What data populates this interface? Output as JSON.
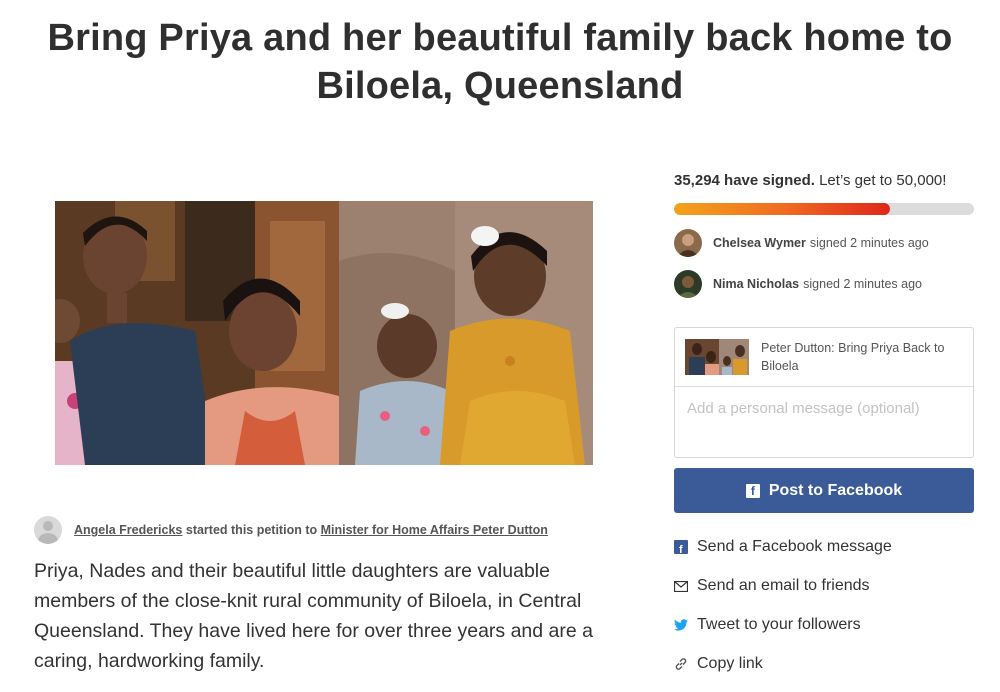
{
  "petition": {
    "title": "Bring Priya and her beautiful family back home to Biloela, Queensland",
    "starter_name": "Angela Fredericks",
    "starter_mid": " started this petition to ",
    "target": "Minister for Home Affairs Peter Dutton",
    "description": " Priya, Nades and their beautiful little daughters are valuable members of the close-knit rural community of Biloela, in Central Queensland. They have lived here for over three years and are a caring, hardworking family."
  },
  "signatures": {
    "count_text": "35,294 have signed.",
    "goal_text": "Let’s get to 50,000!",
    "progress_fraction": 0.72,
    "recent": [
      {
        "name": "Chelsea Wymer",
        "action": "signed 2 minutes ago"
      },
      {
        "name": "Nima Nicholas",
        "action": "signed 2 minutes ago"
      }
    ]
  },
  "share": {
    "preview_title": "Peter Dutton: Bring Priya Back to Biloela",
    "message_placeholder": "Add a personal message (optional)",
    "facebook_button": "Post to Facebook",
    "options": [
      {
        "label": "Send a Facebook message",
        "icon": "facebook-icon"
      },
      {
        "label": "Send an email to friends",
        "icon": "email-icon"
      },
      {
        "label": "Tweet to your followers",
        "icon": "twitter-icon"
      },
      {
        "label": "Copy link",
        "icon": "link-icon"
      }
    ]
  },
  "colors": {
    "facebook_blue": "#3b5a98",
    "progress_start": "#f2a21b",
    "progress_end": "#e0261a",
    "twitter_blue": "#1da1f2"
  }
}
